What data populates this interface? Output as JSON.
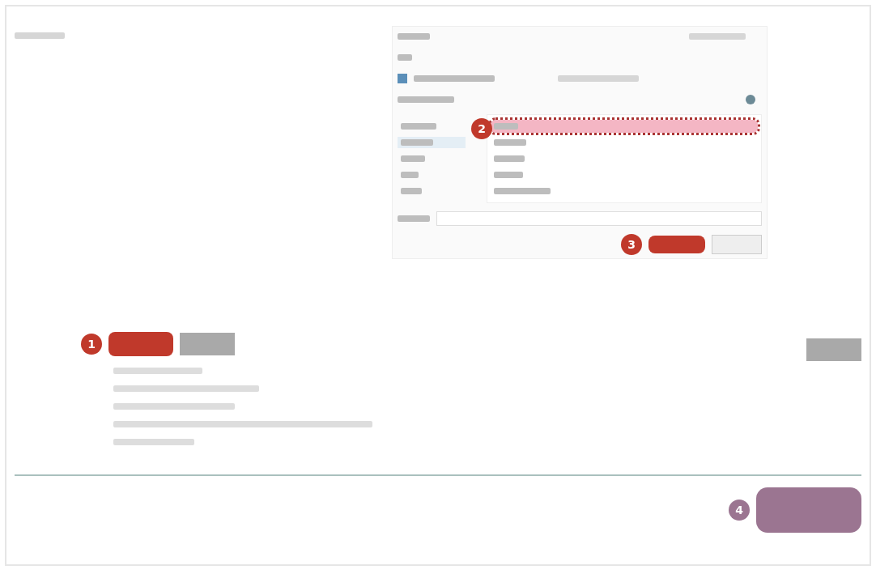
{
  "annotations": [
    {
      "number": "1",
      "color": "#c0392b"
    },
    {
      "number": "2",
      "color": "#c0392b"
    },
    {
      "number": "3",
      "color": "#c0392b"
    },
    {
      "number": "4",
      "color": "#9b7591"
    }
  ],
  "dialog": {
    "places": [
      {
        "selected": false
      },
      {
        "selected": true
      },
      {
        "selected": false
      },
      {
        "selected": false
      },
      {
        "selected": false
      }
    ],
    "files": [
      {
        "selected": true
      },
      {
        "selected": false
      },
      {
        "selected": false
      },
      {
        "selected": false
      },
      {
        "selected": false
      }
    ]
  }
}
